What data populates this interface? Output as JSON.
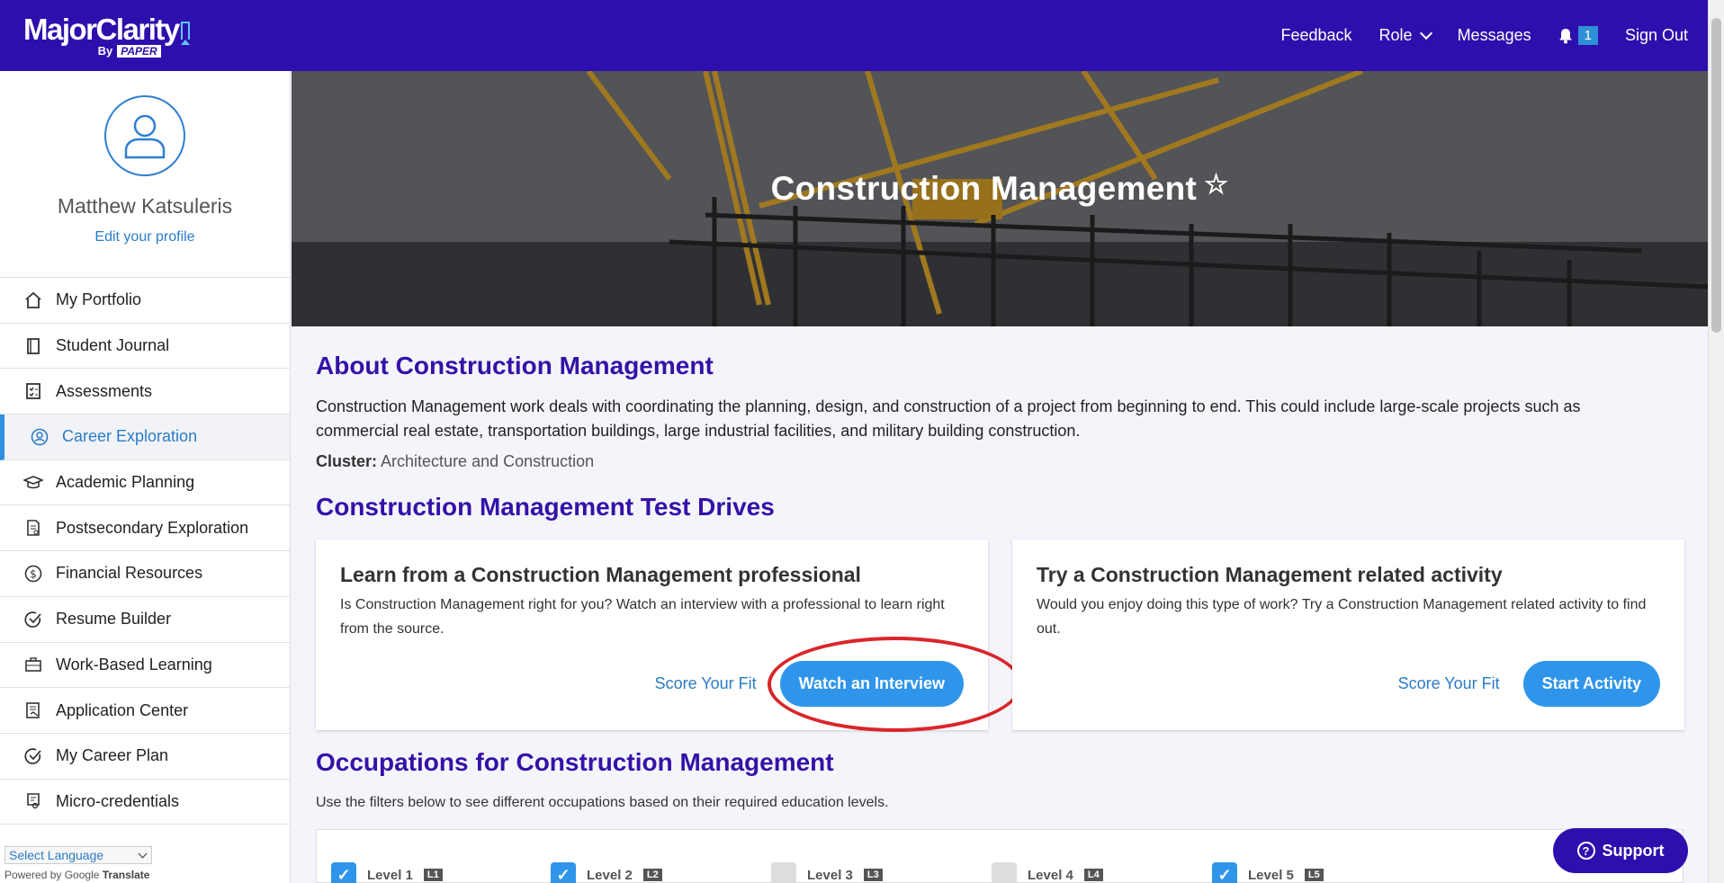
{
  "brand": {
    "name": "MajorClarity",
    "by": "By",
    "partner": "PAPER"
  },
  "header": {
    "feedback": "Feedback",
    "role": "Role",
    "messages": "Messages",
    "notification_count": "1",
    "sign_out": "Sign Out"
  },
  "profile": {
    "name": "Matthew Katsuleris",
    "edit_label": "Edit your profile"
  },
  "sidebar": {
    "items": [
      {
        "label": "My Portfolio",
        "icon": "home-icon"
      },
      {
        "label": "Student Journal",
        "icon": "journal-icon"
      },
      {
        "label": "Assessments",
        "icon": "checklist-icon"
      },
      {
        "label": "Career Exploration",
        "icon": "person-circle-icon",
        "active": true
      },
      {
        "label": "Academic Planning",
        "icon": "graduation-cap-icon"
      },
      {
        "label": "Postsecondary Exploration",
        "icon": "document-icon"
      },
      {
        "label": "Financial Resources",
        "icon": "dollar-icon"
      },
      {
        "label": "Resume Builder",
        "icon": "check-circle-icon"
      },
      {
        "label": "Work-Based Learning",
        "icon": "briefcase-icon"
      },
      {
        "label": "Application Center",
        "icon": "form-icon"
      },
      {
        "label": "My Career Plan",
        "icon": "check-circle-icon"
      },
      {
        "label": "Micro-credentials",
        "icon": "certificate-icon"
      }
    ],
    "language_select": "Select Language",
    "powered_by": "Powered by",
    "google": "Google",
    "translate": "Translate"
  },
  "hero": {
    "title": "Construction Management"
  },
  "about": {
    "title": "About Construction Management",
    "text": "Construction Management work deals with coordinating the planning, design, and construction of a project from beginning to end. This could include large-scale projects such as commercial real estate, transportation buildings, large industrial facilities, and military building construction.",
    "cluster_label": "Cluster:",
    "cluster_value": "Architecture and Construction"
  },
  "test_drives": {
    "title": "Construction Management Test Drives",
    "cards": [
      {
        "title": "Learn from a Construction Management professional",
        "text": "Is Construction Management right for you? Watch an interview with a professional to learn right from the source.",
        "secondary": "Score Your Fit",
        "primary": "Watch an Interview"
      },
      {
        "title": "Try a Construction Management related activity",
        "text": "Would you enjoy doing this type of work? Try a Construction Management related activity to find out.",
        "secondary": "Score Your Fit",
        "primary": "Start Activity"
      }
    ]
  },
  "occupations": {
    "title": "Occupations for Construction Management",
    "text": "Use the filters below to see different occupations based on their required education levels.",
    "levels": [
      {
        "label": "Level 1",
        "tag": "L1",
        "checked": true
      },
      {
        "label": "Level 2",
        "tag": "L2",
        "checked": true
      },
      {
        "label": "Level 3",
        "tag": "L3",
        "checked": false
      },
      {
        "label": "Level 4",
        "tag": "L4",
        "checked": false
      },
      {
        "label": "Level 5",
        "tag": "L5",
        "checked": true
      }
    ]
  },
  "support": {
    "label": "Support"
  },
  "colors": {
    "header_bg": "#2e0fad",
    "heading": "#3412a8",
    "link": "#2a7cc7",
    "button": "#2f95ea",
    "highlight_ring": "#d9262b"
  }
}
